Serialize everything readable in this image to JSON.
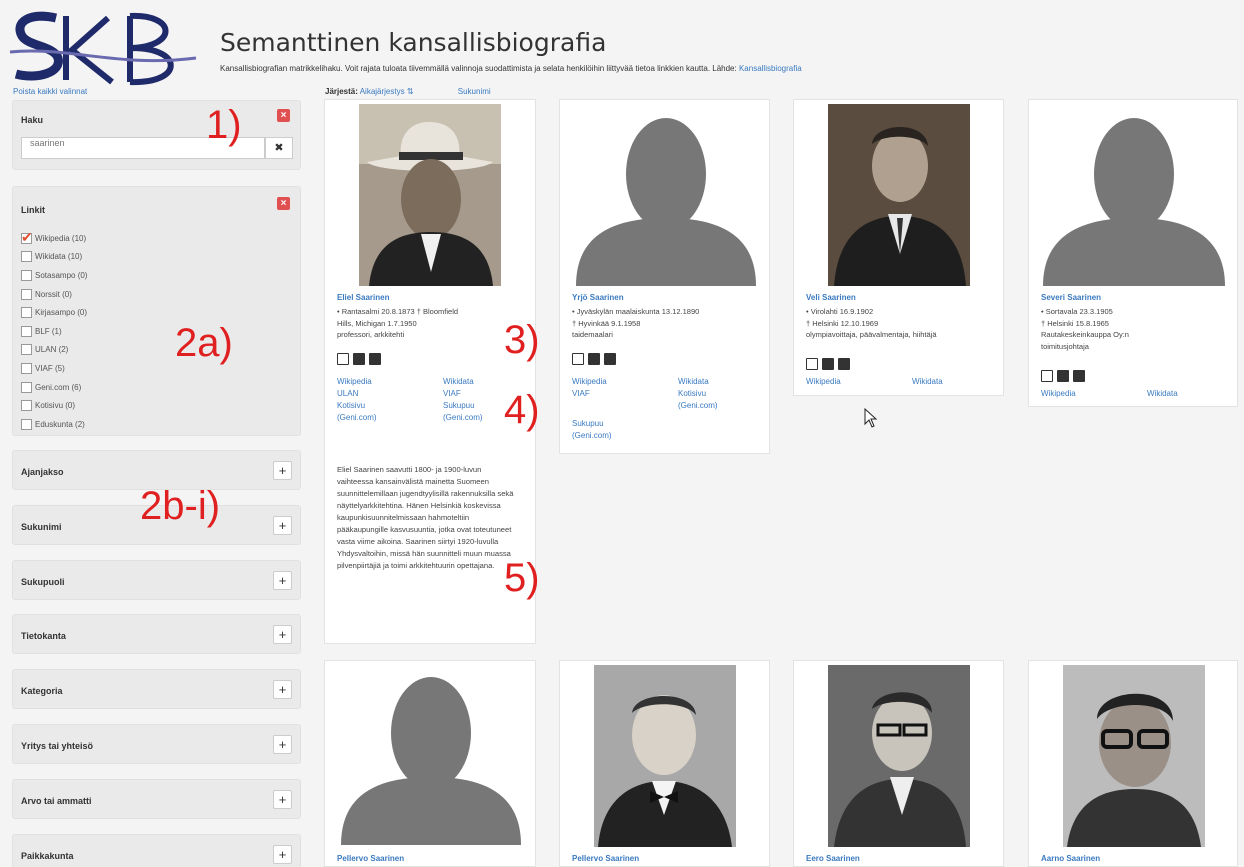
{
  "header": {
    "title": "Semanttinen kansallisbiografia",
    "subtitle": "Kansallisbiografian matrikkelihaku. Voit rajata tuloata tiivemmällä valinnoja suodattimista ja selata henkilöihin liittyvää tietoa linkkien kautta. Lähde:",
    "subtitle_link": "Kansallisbiografia",
    "clear_all": "Poista kaikki valinnat"
  },
  "sort": {
    "label": "Järjestä:",
    "option1": "Aikajärjestys ⇅",
    "option2": "Sukunimi"
  },
  "search": {
    "title": "Haku",
    "value": "saarinen",
    "clear": "✖"
  },
  "links_facet": {
    "title": "Linkit",
    "items": [
      {
        "label": "Wikipedia (10)",
        "checked": true
      },
      {
        "label": "Wikidata (10)",
        "checked": false
      },
      {
        "label": "Sotasampo (0)",
        "checked": false
      },
      {
        "label": "Norssit (0)",
        "checked": false
      },
      {
        "label": "Kirjasampo (0)",
        "checked": false
      },
      {
        "label": "BLF (1)",
        "checked": false
      },
      {
        "label": "ULAN (2)",
        "checked": false
      },
      {
        "label": "VIAF (5)",
        "checked": false
      },
      {
        "label": "Geni.com (6)",
        "checked": false
      },
      {
        "label": "Kotisivu (0)",
        "checked": false
      },
      {
        "label": "Eduskunta (2)",
        "checked": false
      }
    ]
  },
  "facets": [
    "Ajanjakso",
    "Sukunimi",
    "Sukupuoli",
    "Tietokanta",
    "Kategoria",
    "Yritys tai yhteisö",
    "Arvo tai ammatti",
    "Paikkakunta"
  ],
  "annotations": [
    "1)",
    "2a)",
    "2b-i)",
    "3)",
    "4)",
    "5)"
  ],
  "cards": [
    {
      "name": "Eliel Saarinen",
      "line1": "• Rantasalmi 20.8.1873 † Bloomfield",
      "line2": "Hills, Michigan 1.7.1950",
      "line3": "professori, arkkitehti",
      "links": [
        "Wikipedia",
        "Wikidata",
        "ULAN",
        "VIAF",
        "Kotisivu",
        "Sukupuu",
        "(Geni.com)",
        "(Geni.com)"
      ],
      "desc": "Eliel Saarinen saavutti 1800- ja 1900-luvun vaihteessa kansainvälistä mainetta Suomeen suunnittelemillaan jugendtyylisillä rakennuksilla sekä näyttelyarkkitehtina. Hänen Helsinkiä koskevissa kaupunkisuunnitelmissaan hahmoteltiin pääkaupungille kasvusuuntia, jotka ovat toteutuneet vasta viime aikoina. Saarinen siirtyi 1920-luvulla Yhdysvaltoihin, missä hän suunnitteli muun muassa pilvenpiirtäjiä ja toimi arkkitehtuurin opettajana."
    },
    {
      "name": "Yrjö Saarinen",
      "line1": "• Jyväskylän maalaiskunta 13.12.1890",
      "line2": "† Hyvinkää 9.1.1958",
      "line3": "taidemaalari",
      "links": [
        "Wikipedia",
        "Wikidata",
        "VIAF",
        "Kotisivu",
        "(Geni.com)",
        "Sukupuu",
        "(Geni.com)"
      ]
    },
    {
      "name": "Veli Saarinen",
      "line1": "• Virolahti 16.9.1902",
      "line2": "† Helsinki 12.10.1969",
      "line3": "olympiavoittaja, päävalmentaja, hiihtäjä",
      "links": [
        "Wikipedia",
        "Wikidata"
      ]
    },
    {
      "name": "Severi Saarinen",
      "line1": "• Sortavala 23.3.1905",
      "line2": "† Helsinki 15.8.1965",
      "line3": "Rautakeskeinkauppa Oy:n",
      "line4": "toimitusjohtaja",
      "links": [
        "Wikipedia",
        "Wikidata"
      ]
    },
    {
      "name": "Pellervo Saarinen"
    },
    {
      "name": "Pellervo Saarinen"
    },
    {
      "name": "Eero Saarinen"
    },
    {
      "name": "Aarno Saarinen"
    }
  ],
  "colors": {
    "accent": "#3a7ac0",
    "annotation": "#e02020",
    "remove": "#e05050"
  }
}
